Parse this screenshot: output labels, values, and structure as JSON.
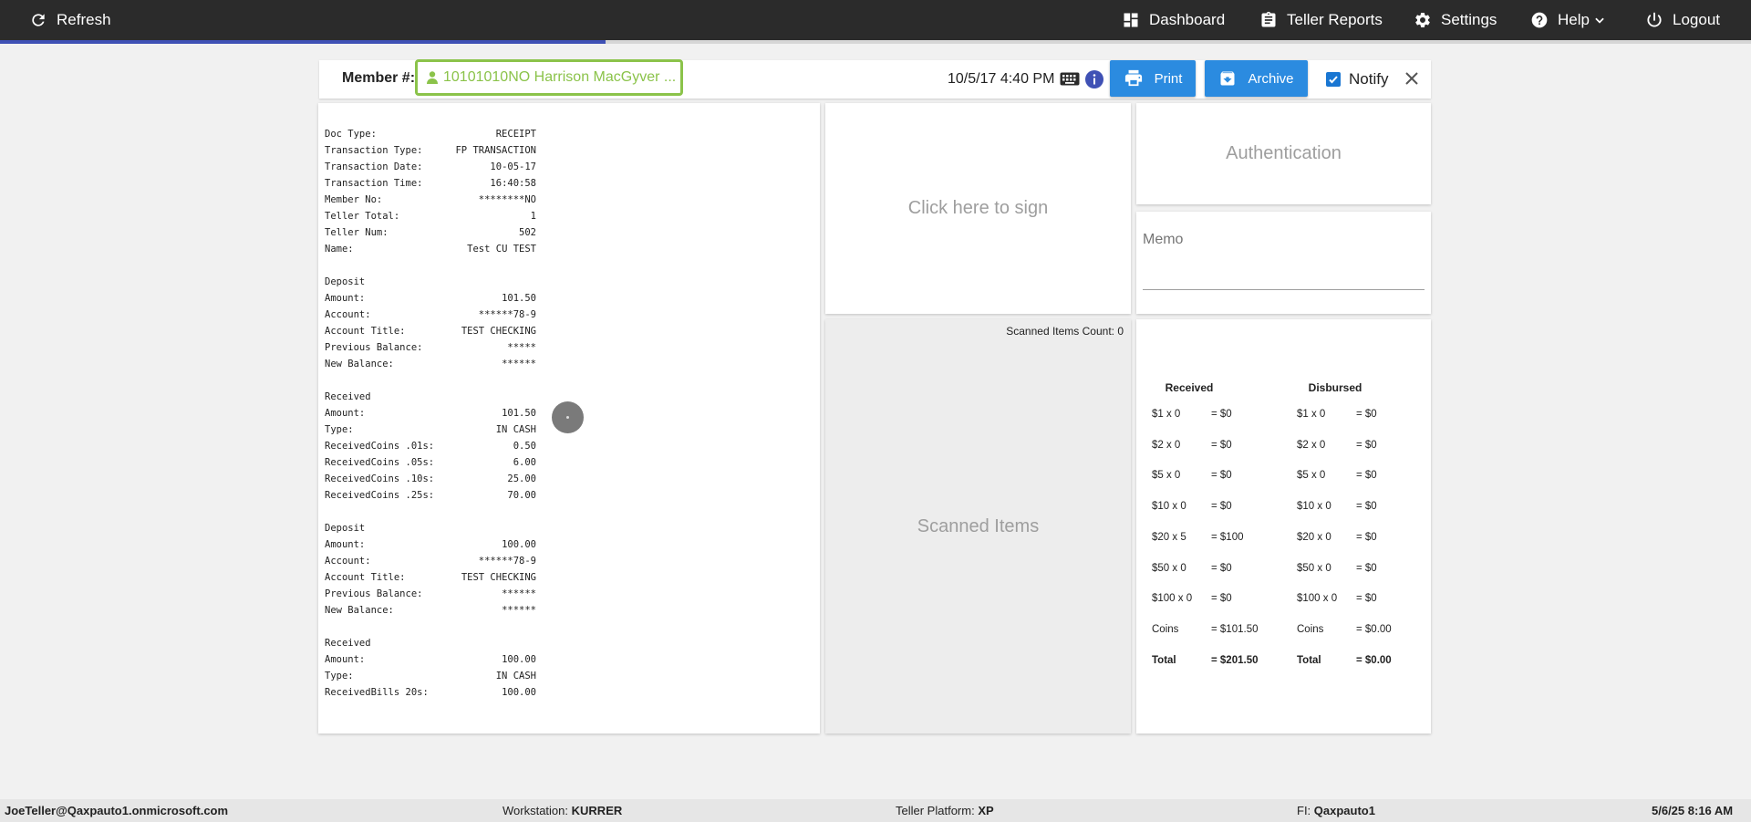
{
  "topbar": {
    "refresh_label": "Refresh",
    "dashboard_label": "Dashboard",
    "teller_reports_label": "Teller Reports",
    "settings_label": "Settings",
    "help_label": "Help",
    "logout_label": "Logout",
    "progress_fraction": 0.346
  },
  "header": {
    "member_label": "Member #:",
    "member_value": "10101010NO Harrison MacGyver ...",
    "datetime": "10/5/17 4:40 PM",
    "print_label": "Print",
    "archive_label": "Archive",
    "notify_label": "Notify",
    "notify_checked": true
  },
  "receipt": {
    "lines": [
      [
        "Doc Type:",
        "RECEIPT"
      ],
      [
        "Transaction Type:",
        "FP TRANSACTION"
      ],
      [
        "Transaction Date:",
        "10-05-17"
      ],
      [
        "Transaction Time:",
        "16:40:58"
      ],
      [
        "Member No:",
        "********NO"
      ],
      [
        "Teller Total:",
        "1"
      ],
      [
        "Teller Num:",
        "502"
      ],
      [
        "Name:",
        "Test CU TEST"
      ],
      [
        "",
        ""
      ],
      [
        "Deposit",
        ""
      ],
      [
        "Amount:",
        "101.50"
      ],
      [
        "Account:",
        "******78-9"
      ],
      [
        "Account Title:",
        "TEST CHECKING"
      ],
      [
        "Previous Balance:",
        "*****"
      ],
      [
        "New Balance:",
        "******"
      ],
      [
        "",
        ""
      ],
      [
        "Received",
        ""
      ],
      [
        "Amount:",
        "101.50"
      ],
      [
        "Type:",
        "IN CASH"
      ],
      [
        "ReceivedCoins .01s:",
        "0.50"
      ],
      [
        "ReceivedCoins .05s:",
        "6.00"
      ],
      [
        "ReceivedCoins .10s:",
        "25.00"
      ],
      [
        "ReceivedCoins .25s:",
        "70.00"
      ],
      [
        "",
        ""
      ],
      [
        "Deposit",
        ""
      ],
      [
        "Amount:",
        "100.00"
      ],
      [
        "Account:",
        "******78-9"
      ],
      [
        "Account Title:",
        "TEST CHECKING"
      ],
      [
        "Previous Balance:",
        "******"
      ],
      [
        "New Balance:",
        "******"
      ],
      [
        "",
        ""
      ],
      [
        "Received",
        ""
      ],
      [
        "Amount:",
        "100.00"
      ],
      [
        "Type:",
        "IN CASH"
      ],
      [
        "ReceivedBills 20s:",
        "100.00"
      ]
    ]
  },
  "sign": {
    "label": "Click here to sign"
  },
  "scanned": {
    "count_text": "Scanned Items Count: 0",
    "title": "Scanned Items"
  },
  "auth": {
    "label": "Authentication"
  },
  "memo": {
    "label": "Memo",
    "value": ""
  },
  "cash": {
    "received_header": "Received",
    "disbursed_header": "Disbursed",
    "rows": [
      {
        "r_label": "$1 x 0",
        "r_value": "= $0",
        "d_label": "$1 x 0",
        "d_value": "= $0"
      },
      {
        "r_label": "$2 x 0",
        "r_value": "= $0",
        "d_label": "$2 x 0",
        "d_value": "= $0"
      },
      {
        "r_label": "$5 x 0",
        "r_value": "= $0",
        "d_label": "$5 x 0",
        "d_value": "= $0"
      },
      {
        "r_label": "$10 x 0",
        "r_value": "= $0",
        "d_label": "$10 x 0",
        "d_value": "= $0"
      },
      {
        "r_label": "$20 x 5",
        "r_value": "= $100",
        "d_label": "$20 x 0",
        "d_value": "= $0"
      },
      {
        "r_label": "$50 x 0",
        "r_value": "= $0",
        "d_label": "$50 x 0",
        "d_value": "= $0"
      },
      {
        "r_label": "$100 x 0",
        "r_value": "= $0",
        "d_label": "$100 x 0",
        "d_value": "= $0"
      },
      {
        "r_label": "Coins",
        "r_value": "= $101.50",
        "d_label": "Coins",
        "d_value": "= $0.00"
      },
      {
        "r_label": "Total",
        "r_value": "= $201.50",
        "d_label": "Total",
        "d_value": "= $0.00"
      }
    ]
  },
  "footer": {
    "user": "JoeTeller@Qaxpauto1.onmicrosoft.com",
    "workstation_label": "Workstation:",
    "workstation_value": "KURRER",
    "platform_label": "Teller Platform:",
    "platform_value": "XP",
    "fi_label": "FI:",
    "fi_value": "Qaxpauto1",
    "datetime": "5/6/25 8:16 AM"
  },
  "colors": {
    "topbar": "#2b2b2b",
    "accent_blue": "#2b8be0",
    "member_green": "#8bc34a",
    "progress": "#3f51b5"
  }
}
